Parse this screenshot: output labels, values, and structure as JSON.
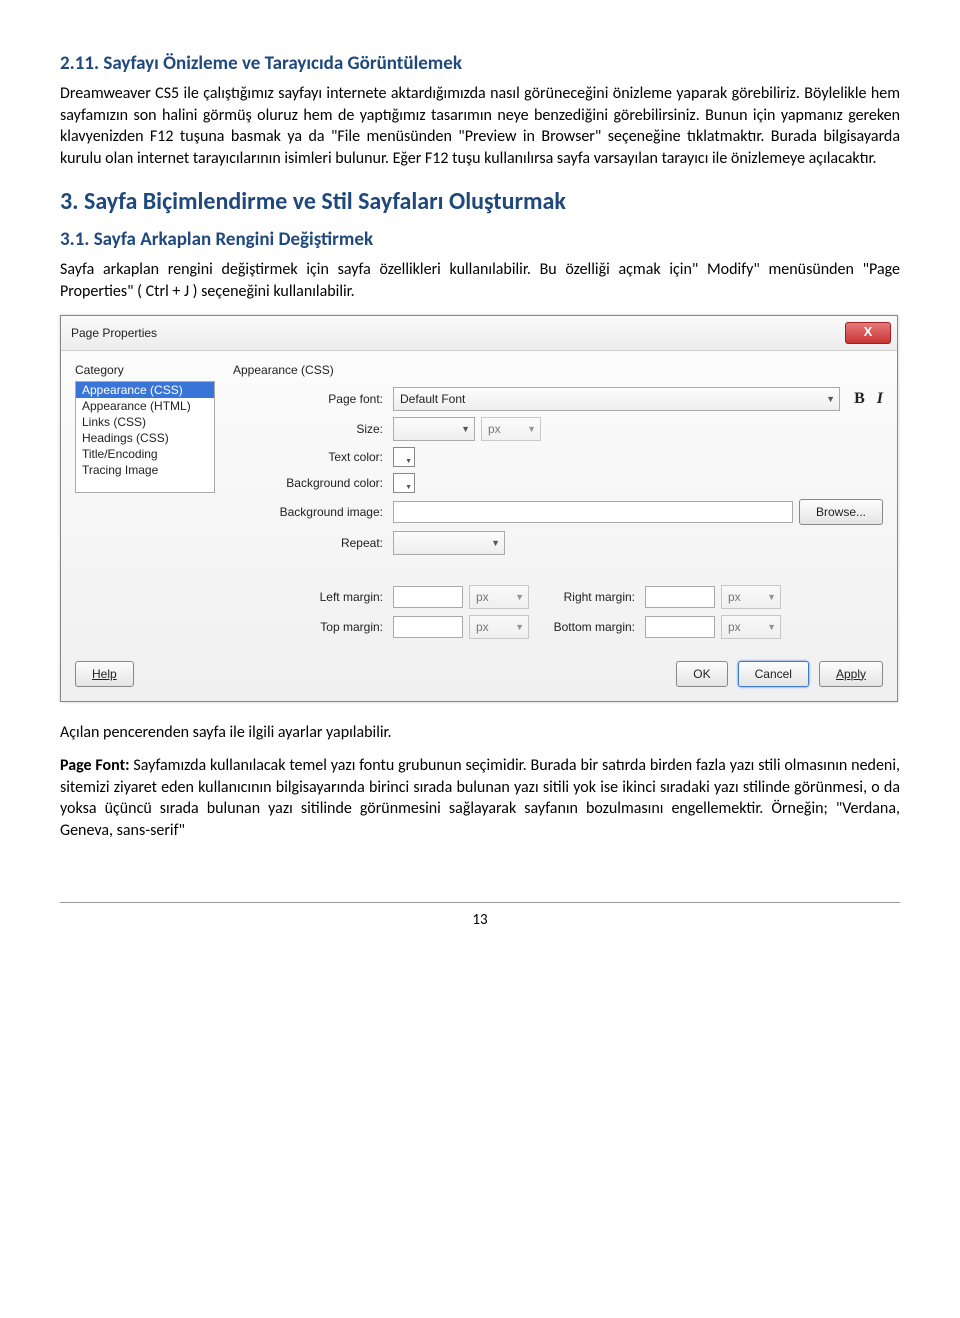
{
  "doc": {
    "h_2_11": "2.11. Sayfayı Önizleme ve Tarayıcıda Görüntülemek",
    "p_2_11_a": "Dreamweaver CS5 ile çalıştığımız sayfayı internete aktardığımızda nasıl görüneceğini önizleme yaparak görebiliriz. Böylelikle hem sayfamızın son halini görmüş oluruz hem de yaptığımız tasarımın neye benzediğini görebilirsiniz. Bunun için yapmanız gereken klavyenizden F12 tuşuna basmak ya da \"File menüsünden \"Preview in Browser\" seçeneğine tıklatmaktır. Burada bilgisayarda kurulu olan internet tarayıcılarının isimleri bulunur. Eğer F12 tuşu kullanılırsa sayfa varsayılan tarayıcı ile önizlemeye açılacaktır.",
    "h_3": "3. Sayfa Biçimlendirme ve Stil Sayfaları Oluşturmak",
    "h_3_1": "3.1. Sayfa Arkaplan Rengini Değiştirmek",
    "p_3_1": "Sayfa arkaplan rengini değiştirmek için sayfa özellikleri kullanılabilir. Bu özelliği açmak için\" Modify\" menüsünden \"Page Properties\" ( Ctrl + J ) seçeneğini kullanılabilir.",
    "p_after_a": "Açılan pencerenden sayfa ile ilgili ayarlar yapılabilir.",
    "p_after_b": "Page Font: Sayfamızda kullanılacak temel yazı fontu grubunun seçimidir. Burada bir satırda birden fazla yazı stili olmasının nedeni, sitemizi ziyaret eden kullanıcının bilgisayarında birinci sırada bulunan yazı sitili yok ise ikinci sıradaki yazı stilinde görünmesi, o da yoksa üçüncü sırada bulunan yazı sitilinde görünmesini sağlayarak sayfanın bozulmasını engellemektir. Örneğin; \"Verdana, Geneva, sans-serif\"",
    "page_num": "13"
  },
  "dialog": {
    "title": "Page Properties",
    "close": "X",
    "category_label": "Category",
    "categories": [
      "Appearance (CSS)",
      "Appearance (HTML)",
      "Links (CSS)",
      "Headings (CSS)",
      "Title/Encoding",
      "Tracing Image"
    ],
    "group_title": "Appearance (CSS)",
    "labels": {
      "page_font": "Page font:",
      "size": "Size:",
      "text_color": "Text color:",
      "bg_color": "Background color:",
      "bg_image": "Background image:",
      "repeat": "Repeat:",
      "left_margin": "Left margin:",
      "right_margin": "Right margin:",
      "top_margin": "Top margin:",
      "bottom_margin": "Bottom margin:"
    },
    "values": {
      "page_font": "Default Font",
      "unit": "px",
      "bold": "B",
      "italic": "I"
    },
    "buttons": {
      "browse": "Browse...",
      "help": "Help",
      "ok": "OK",
      "cancel": "Cancel",
      "apply": "Apply"
    }
  }
}
